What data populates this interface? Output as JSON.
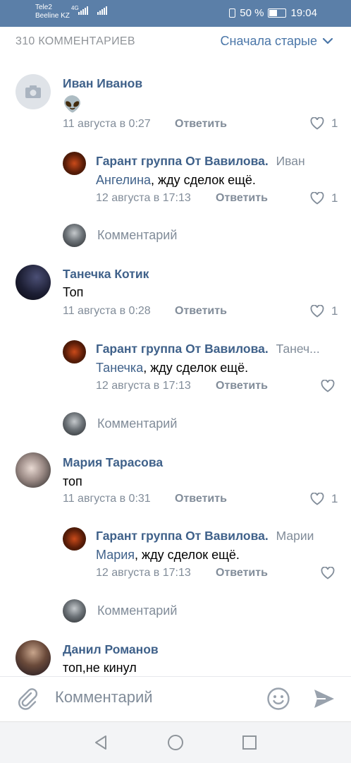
{
  "status_bar": {
    "operator_1": "Tele2",
    "operator_2": "Beeline KZ",
    "network": "4G",
    "battery": "50 %",
    "time": "19:04"
  },
  "header": {
    "count": "310 КОММЕНТАРИЕВ",
    "sort": "Сначала старые"
  },
  "comments": [
    {
      "name": "Иван Иванов",
      "text": "👽",
      "date": "11 августа в 0:27",
      "reply": "Ответить",
      "likes": "1",
      "answer": {
        "name": "Гарант группа От Вавилова.",
        "to": "Иван",
        "mention": "Ангелина",
        "text": ", жду сделок ещё.",
        "date": "12 августа в 17:13",
        "reply": "Ответить",
        "likes": "1"
      }
    },
    {
      "name": "Танечка Котик",
      "text": "Топ",
      "date": "11 августа в 0:28",
      "reply": "Ответить",
      "likes": "1",
      "answer": {
        "name": "Гарант группа От Вавилова.",
        "to": "Танеч...",
        "mention": "Танечка",
        "text": ", жду сделок ещё.",
        "date": "12 августа в 17:13",
        "reply": "Ответить",
        "likes": ""
      }
    },
    {
      "name": "Мария Тарасова",
      "text": "топ",
      "date": "11 августа в 0:31",
      "reply": "Ответить",
      "likes": "1",
      "answer": {
        "name": "Гарант группа От Вавилова.",
        "to": "Марии",
        "mention": "Мария",
        "text": ", жду сделок ещё.",
        "date": "12 августа в 17:13",
        "reply": "Ответить",
        "likes": ""
      }
    },
    {
      "name": "Данил Романов",
      "text": "топ,не кинул"
    }
  ],
  "reply_placeholder": "Комментарий",
  "bottom": {
    "placeholder": "Комментарий"
  },
  "colors": {
    "status_bar": "#5b7fa8",
    "link": "#4a76a8",
    "name": "#3f618a",
    "meta": "#818c99"
  }
}
